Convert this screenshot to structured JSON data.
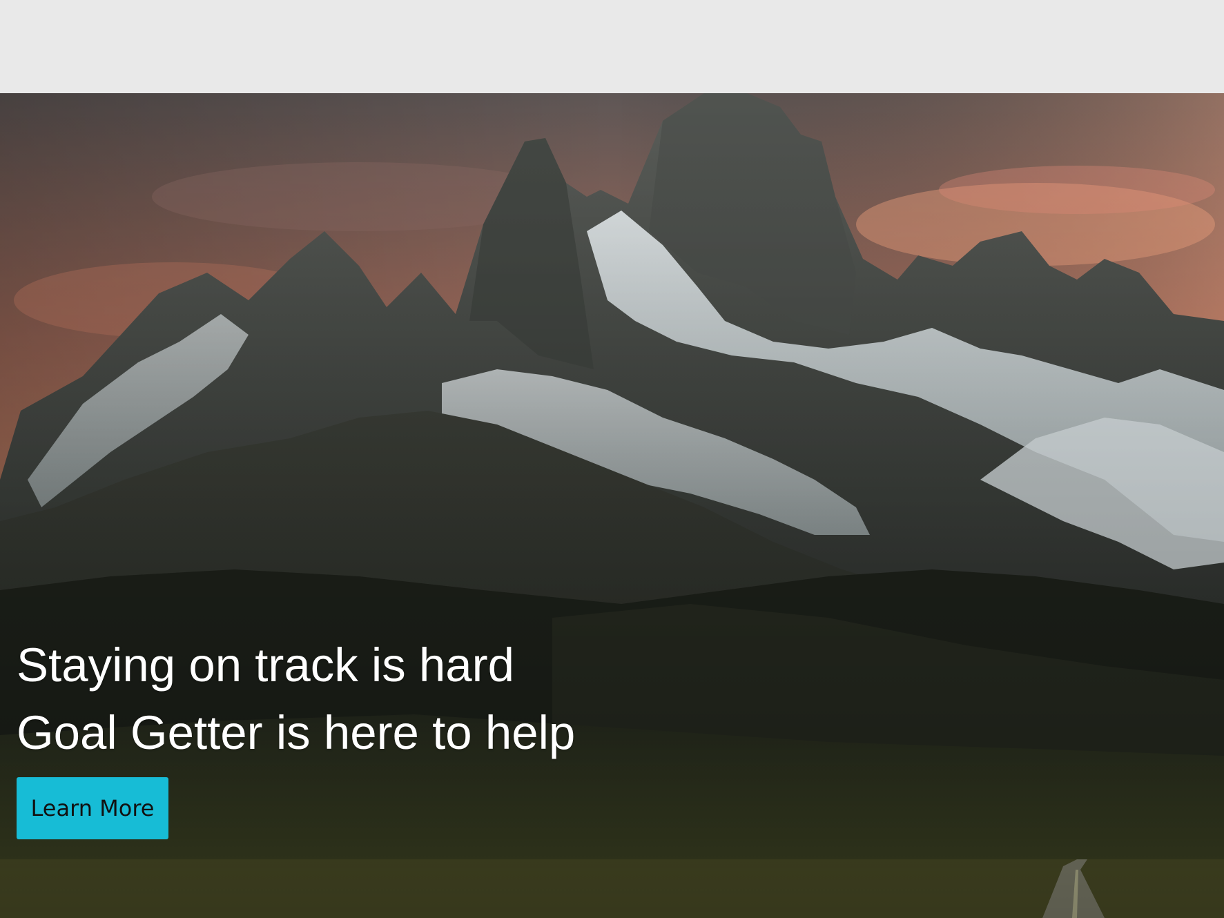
{
  "hero": {
    "line1": "Staying on track is hard",
    "line2": "Goal Getter is here to help",
    "cta_label": "Learn More"
  },
  "colors": {
    "topbar": "#e9e9e9",
    "cta_background": "#17bcd6",
    "cta_text": "#111111",
    "headline_text": "#ffffff"
  }
}
